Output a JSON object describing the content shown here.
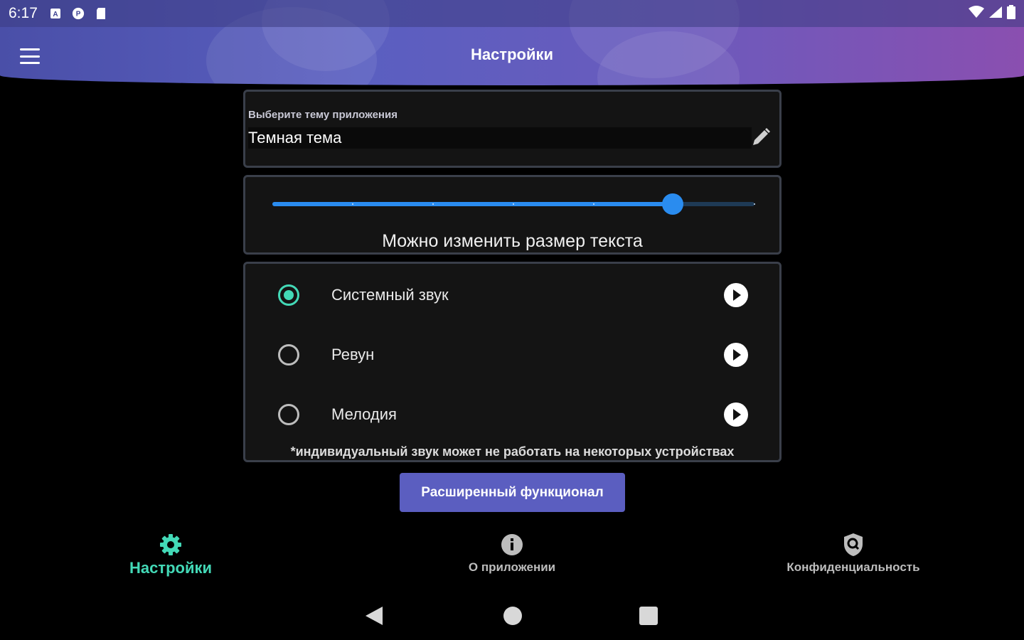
{
  "status_bar": {
    "time": "6:17",
    "left_icons": [
      "a-notification-icon",
      "p-notification-icon",
      "sd-card-icon"
    ],
    "right_icons": [
      "wifi-icon",
      "cell-signal-icon",
      "battery-icon"
    ]
  },
  "app_bar": {
    "title": "Настройки",
    "menu_icon": "hamburger-menu-icon"
  },
  "theme": {
    "label": "Выберите тему приложения",
    "value": "Темная тема",
    "edit_icon": "pencil-icon"
  },
  "text_size": {
    "caption": "Можно изменить размер текста",
    "level_fraction": 0.83,
    "ticks": 7
  },
  "sound": {
    "options": [
      {
        "label": "Системный звук",
        "selected": true
      },
      {
        "label": "Ревун",
        "selected": false
      },
      {
        "label": "Мелодия",
        "selected": false
      }
    ],
    "note": "*индивидуальный звук может не работать на некоторых устройствах"
  },
  "pro_button": {
    "label": "Расширенный функционал"
  },
  "bottom_nav": {
    "items": [
      {
        "label": "Настройки",
        "icon": "gear-icon",
        "active": true
      },
      {
        "label": "О приложении",
        "icon": "info-icon",
        "active": false
      },
      {
        "label": "Конфиденциальность",
        "icon": "shield-search-icon",
        "active": false
      }
    ]
  },
  "colors": {
    "accent": "#43d9b7",
    "slider": "#2a8cef",
    "button": "#5b5ec0",
    "header_start": "#4a4fa8",
    "header_end": "#8a4fb0",
    "card_bg": "#141414"
  }
}
